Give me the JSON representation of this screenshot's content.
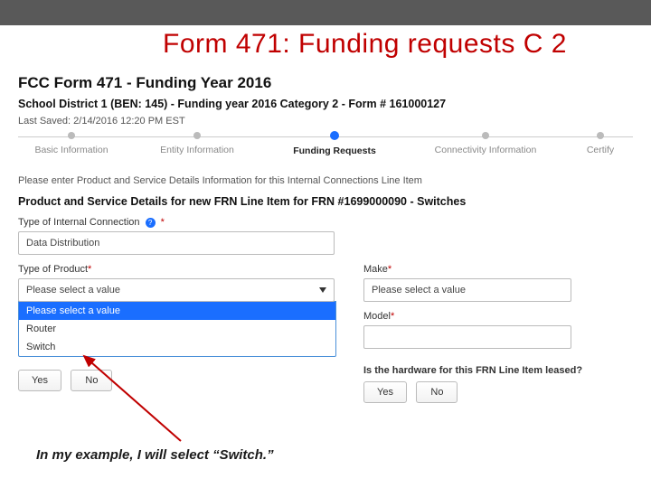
{
  "slide_title": "Form 471:  Funding requests C 2",
  "form": {
    "heading": "FCC Form 471 - Funding Year 2016",
    "subheading": "School District 1 (BEN: 145) - Funding year 2016 Category 2 - Form # 161000127",
    "last_saved": "Last Saved: 2/14/2016 12:20 PM EST",
    "steps": {
      "s1": "Basic Information",
      "s2": "Entity Information",
      "s3": "Funding Requests",
      "s4": "Connectivity Information",
      "s5": "Certify"
    },
    "instruction": "Please enter Product and Service Details Information for this Internal Connections Line Item",
    "section_title": "Product and Service Details for new FRN Line Item for FRN #1699000090 - Switches",
    "type_conn_label": "Type of Internal Connection",
    "type_conn_value": "Data Distribution",
    "type_product_label": "Type of Product",
    "type_product_value": "Please select a value",
    "dropdown": {
      "opt1": "Please select a value",
      "opt2": "Router",
      "opt3": "Switch"
    },
    "make_label": "Make",
    "make_value": "Please select a value",
    "model_label": "Model",
    "model_value": "",
    "leased_q1": "Is the hardware for this FRN Line Item leased?",
    "yes": "Yes",
    "no": "No",
    "req": "*"
  },
  "caption": "In my example, I will select “Switch.”"
}
